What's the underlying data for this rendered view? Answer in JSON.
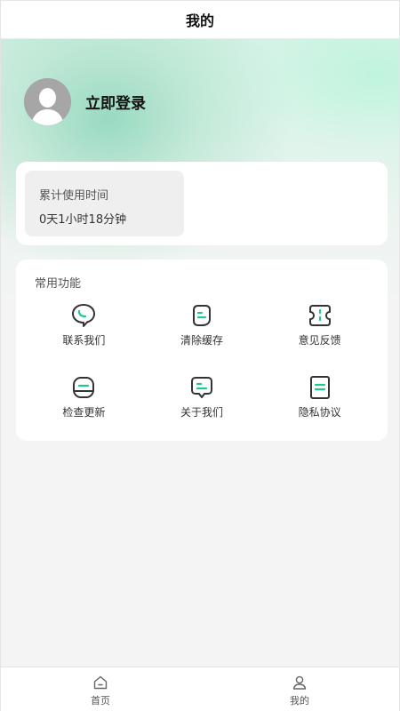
{
  "header": {
    "title": "我的"
  },
  "profile": {
    "login_text": "立即登录",
    "avatar_icon": "default-avatar-icon"
  },
  "usage": {
    "label": "累计使用时间",
    "value": "0天1小时18分钟"
  },
  "functions": {
    "title": "常用功能",
    "accent_color": "#1ec98d",
    "items": [
      {
        "label": "联系我们",
        "icon": "chat-bubble-icon"
      },
      {
        "label": "清除缓存",
        "icon": "broom-doc-icon"
      },
      {
        "label": "意见反馈",
        "icon": "ticket-icon"
      },
      {
        "label": "检查更新",
        "icon": "update-box-icon"
      },
      {
        "label": "关于我们",
        "icon": "info-bubble-icon"
      },
      {
        "label": "隐私协议",
        "icon": "document-icon"
      }
    ]
  },
  "tabbar": {
    "items": [
      {
        "label": "首页",
        "icon": "home-icon"
      },
      {
        "label": "我的",
        "icon": "user-icon"
      }
    ]
  }
}
